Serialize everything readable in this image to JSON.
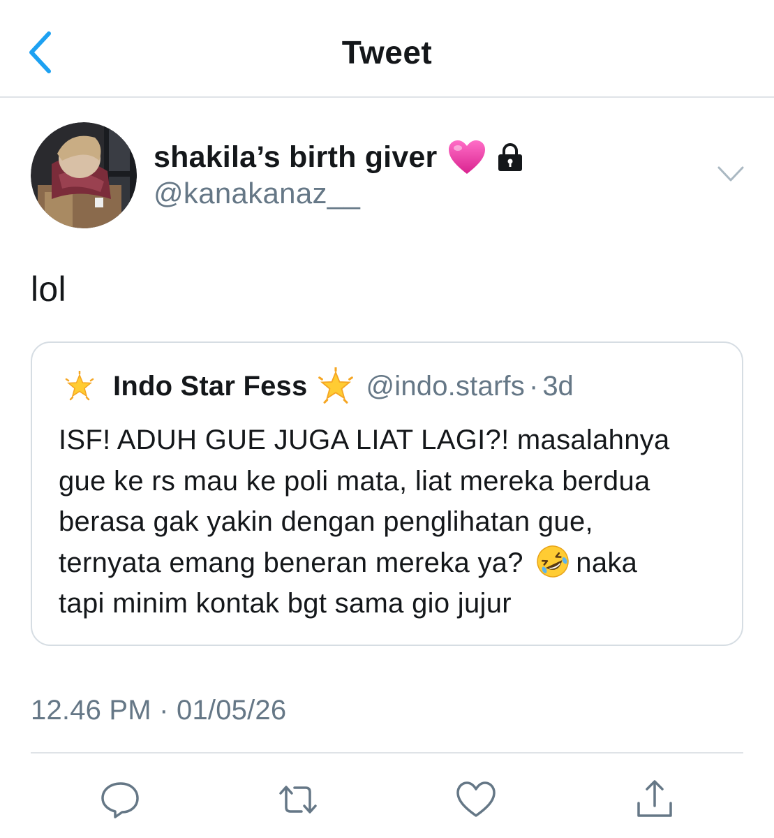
{
  "nav": {
    "title": "Tweet"
  },
  "author": {
    "display_name": "shakila’s birth giver",
    "handle": "@kanakanaz__"
  },
  "tweet": {
    "text": "lol"
  },
  "quoted_tweet": {
    "display_name": "Indo Star Fess",
    "handle": "@indo.starfs",
    "separator": "·",
    "time_ago": "3d",
    "lines": [
      "ISF! ADUH GUE JUGA LIAT LAGI?! masalahnya",
      "gue ke rs mau ke poli mata, liat mereka berdua",
      "berasa gak yakin dengan penglihatan gue,",
      "ternyata emang beneran mereka ya?",
      "naka",
      "tapi minim kontak bgt sama gio jujur"
    ]
  },
  "timestamp": {
    "time": "12.46 PM",
    "separator": "·",
    "date": "01/05/26"
  },
  "icons": {
    "back": "chevron-left-icon",
    "heart_emoji": "pink-heart-icon",
    "lock": "lock-icon",
    "more": "chevron-down-icon",
    "star": "glowing-star-icon",
    "laugh_emoji": "rolling-laughing-icon",
    "reply": "reply-icon",
    "retweet": "retweet-icon",
    "like": "like-icon",
    "share": "share-icon"
  },
  "colors": {
    "accent": "#1da1f2",
    "text": "#14171a",
    "secondary": "#657786",
    "border": "#dfe3e7"
  }
}
